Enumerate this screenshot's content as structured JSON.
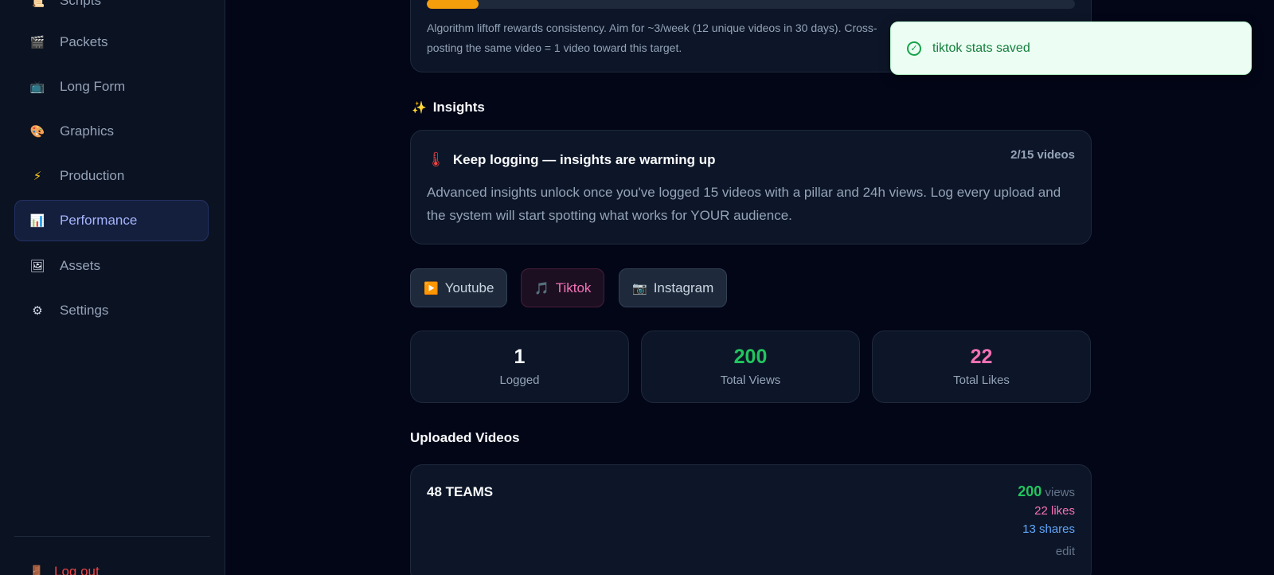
{
  "sidebar": {
    "items": [
      {
        "icon": "scroll-icon",
        "glyph": "📜",
        "label": "Scripts"
      },
      {
        "icon": "clapper-icon",
        "glyph": "🎬",
        "label": "Packets"
      },
      {
        "icon": "tv-icon",
        "glyph": "📺",
        "label": "Long Form"
      },
      {
        "icon": "palette-icon",
        "glyph": "🎨",
        "label": "Graphics"
      },
      {
        "icon": "lightning-icon",
        "glyph": "⚡",
        "label": "Production"
      },
      {
        "icon": "bar-chart-icon",
        "glyph": "📊",
        "label": "Performance"
      },
      {
        "icon": "picture-icon",
        "glyph": "🖼",
        "label": "Assets"
      },
      {
        "icon": "gear-icon",
        "glyph": "⚙",
        "label": "Settings"
      }
    ],
    "logout": {
      "icon": "door-icon",
      "glyph": "🚪",
      "label": "Log out"
    }
  },
  "streak": {
    "progress_fraction": 0.08,
    "text": "Algorithm liftoff rewards consistency. Aim for ~3/week (12 unique videos in 30 days). Cross-posting the same video = 1 video toward this target."
  },
  "insights": {
    "title_icon": "✨",
    "title": "Insights",
    "card_icon": "🌡",
    "heading": "Keep logging — insights are warming up",
    "count": "2/15 videos",
    "body": "Advanced insights unlock once you've logged 15 videos with a pillar and 24h views. Log every upload and the system will start spotting what works for YOUR audience."
  },
  "platform_tabs": [
    {
      "icon": "▶️",
      "label": "Youtube"
    },
    {
      "icon": "🎵",
      "label": "Tiktok"
    },
    {
      "icon": "📷",
      "label": "Instagram"
    }
  ],
  "stats": {
    "logged": {
      "value": "1",
      "label": "Logged"
    },
    "views": {
      "value": "200",
      "label": "Total Views"
    },
    "likes": {
      "value": "22",
      "label": "Total Likes"
    }
  },
  "colors": {
    "accent_active": "#a5b4fc",
    "views_green": "#22c55e",
    "likes_pink": "#f472b6",
    "shares_blue": "#60a5fa",
    "progress_amber": "#f59e0b",
    "logout_red": "#ef4444"
  },
  "uploaded": {
    "title": "Uploaded Videos",
    "videos": [
      {
        "name": "48 TEAMS",
        "views": "200",
        "views_suffix": "views",
        "likes": "22 likes",
        "shares": "13 shares",
        "edit": "edit"
      }
    ]
  },
  "toast": {
    "message": "tiktok stats saved"
  }
}
